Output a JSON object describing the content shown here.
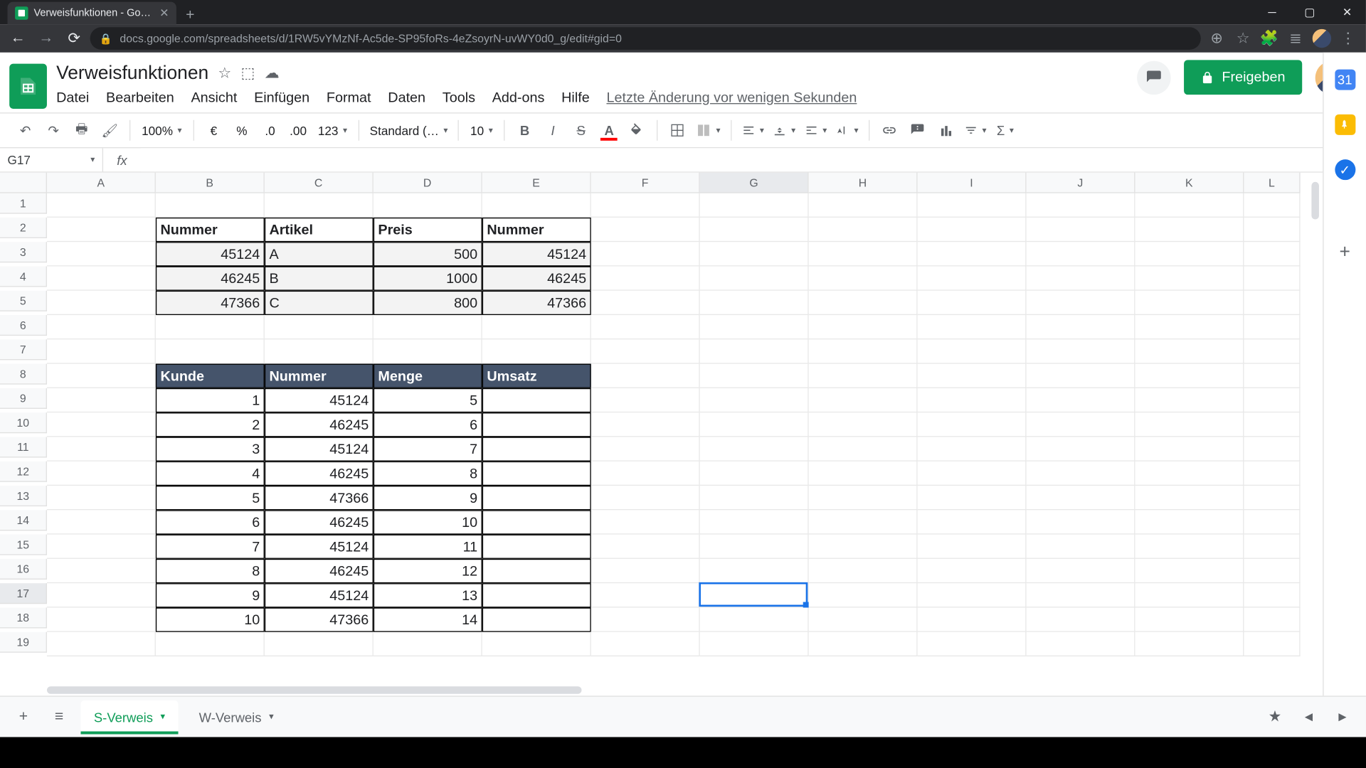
{
  "browser": {
    "tab_title": "Verweisfunktionen - Google Tab…",
    "url": "docs.google.com/spreadsheets/d/1RW5vYMzNf-Ac5de-SP95foRs-4eZsoyrN-uvWY0d0_g/edit#gid=0"
  },
  "doc": {
    "title": "Verweisfunktionen",
    "menus": [
      "Datei",
      "Bearbeiten",
      "Ansicht",
      "Einfügen",
      "Format",
      "Daten",
      "Tools",
      "Add-ons",
      "Hilfe"
    ],
    "last_edit": "Letzte Änderung vor wenigen Sekunden",
    "share": "Freigeben"
  },
  "toolbar": {
    "zoom": "100%",
    "currency": "€",
    "percent": "%",
    "dec_less": ".0",
    "dec_more": ".00",
    "format123": "123",
    "font": "Standard (…",
    "font_size": "10"
  },
  "namebox": "G17",
  "formula": "",
  "columns": [
    "A",
    "B",
    "C",
    "D",
    "E",
    "F",
    "G",
    "H",
    "I",
    "J",
    "K",
    "L"
  ],
  "rows": [
    "1",
    "2",
    "3",
    "4",
    "5",
    "6",
    "7",
    "8",
    "9",
    "10",
    "11",
    "12",
    "13",
    "14",
    "15",
    "16",
    "17",
    "18",
    "19"
  ],
  "table1": {
    "headers": [
      "Nummer",
      "Artikel",
      "Preis",
      "Nummer"
    ],
    "rows": [
      [
        "45124",
        "A",
        "500",
        "45124"
      ],
      [
        "46245",
        "B",
        "1000",
        "46245"
      ],
      [
        "47366",
        "C",
        "800",
        "47366"
      ]
    ]
  },
  "table2": {
    "headers": [
      "Kunde",
      "Nummer",
      "Menge",
      "Umsatz"
    ],
    "rows": [
      [
        "1",
        "45124",
        "5",
        ""
      ],
      [
        "2",
        "46245",
        "6",
        ""
      ],
      [
        "3",
        "45124",
        "7",
        ""
      ],
      [
        "4",
        "46245",
        "8",
        ""
      ],
      [
        "5",
        "47366",
        "9",
        ""
      ],
      [
        "6",
        "46245",
        "10",
        ""
      ],
      [
        "7",
        "45124",
        "11",
        ""
      ],
      [
        "8",
        "46245",
        "12",
        ""
      ],
      [
        "9",
        "45124",
        "13",
        ""
      ],
      [
        "10",
        "47366",
        "14",
        ""
      ]
    ]
  },
  "sheets": {
    "active": "S-Verweis",
    "other": "W-Verweis"
  },
  "active_cell": {
    "col_index": 7,
    "row_index_visual": 17
  }
}
